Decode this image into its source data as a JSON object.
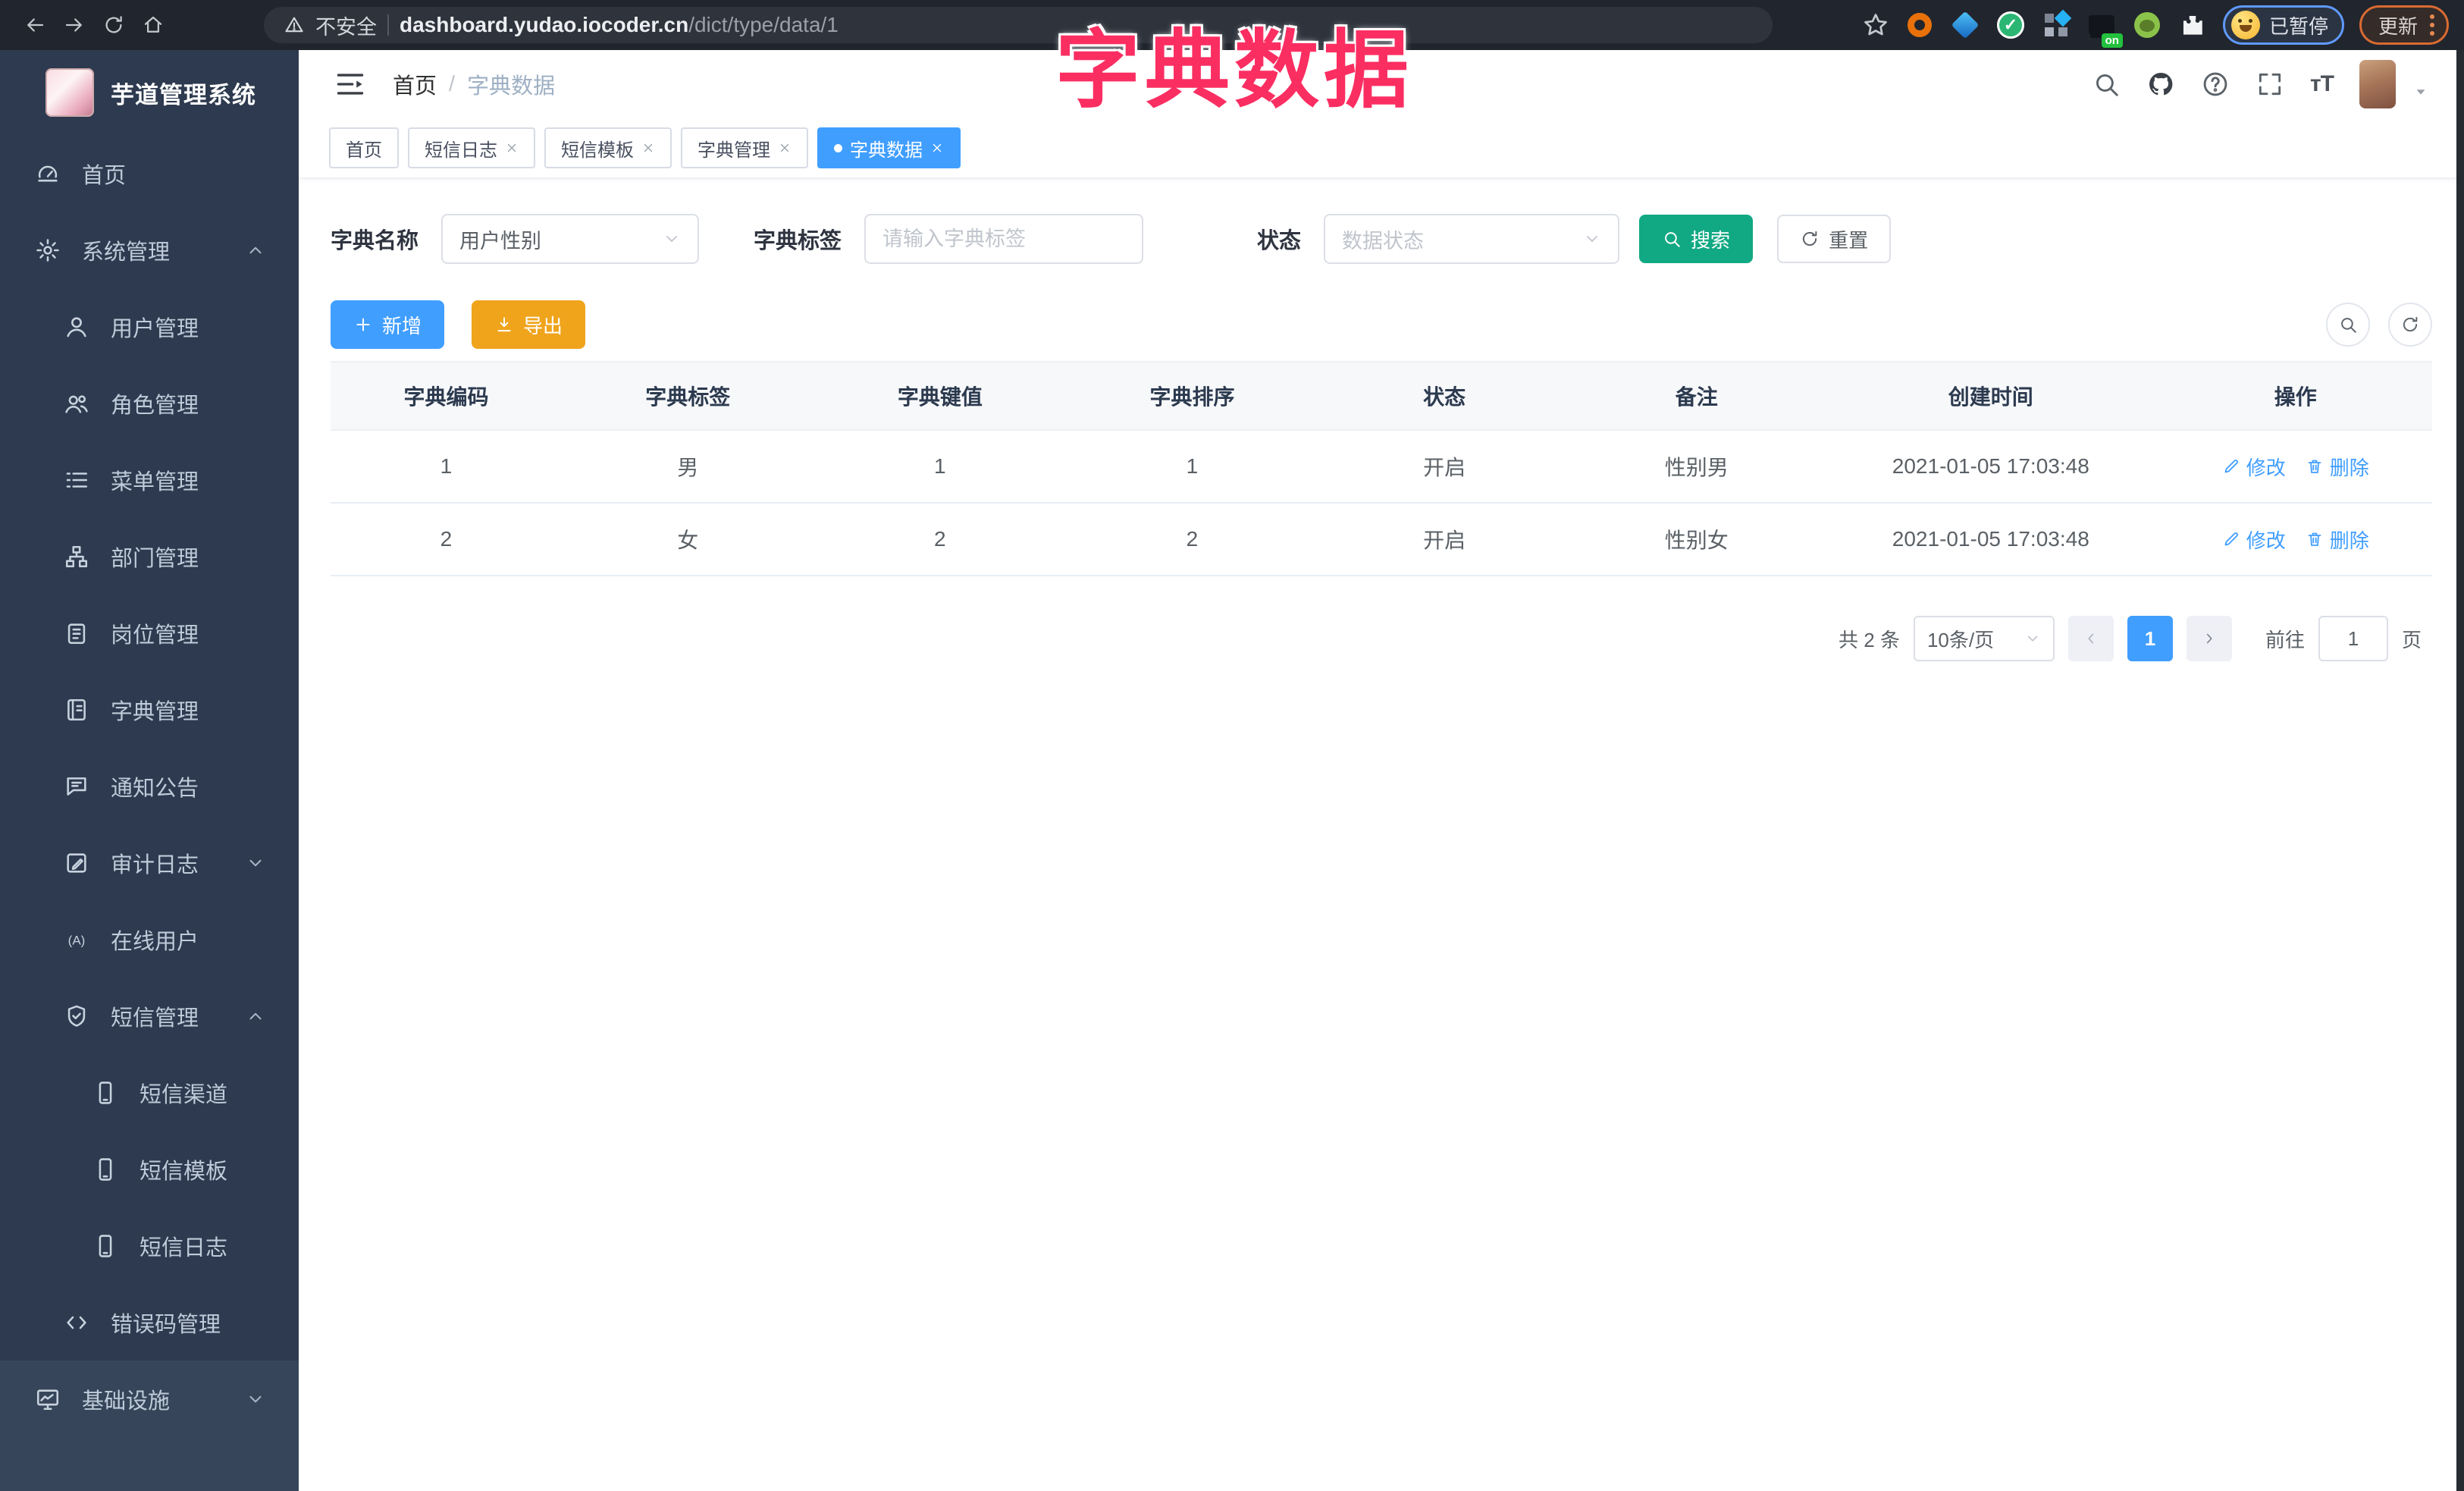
{
  "browser": {
    "security_label": "不安全",
    "url_host": "dashboard.yudao.iocoder.cn",
    "url_path": "/dict/type/data/1",
    "profile_label": "已暂停",
    "update_label": "更新"
  },
  "annotation": {
    "title": "字典数据",
    "color": "#fb2e62"
  },
  "sidebar": {
    "title": "芋道管理系统",
    "items": [
      {
        "label": "首页"
      },
      {
        "label": "系统管理"
      },
      {
        "label": "用户管理"
      },
      {
        "label": "角色管理"
      },
      {
        "label": "菜单管理"
      },
      {
        "label": "部门管理"
      },
      {
        "label": "岗位管理"
      },
      {
        "label": "字典管理"
      },
      {
        "label": "通知公告"
      },
      {
        "label": "审计日志"
      },
      {
        "label": "在线用户"
      },
      {
        "label": "短信管理"
      },
      {
        "label": "短信渠道"
      },
      {
        "label": "短信模板"
      },
      {
        "label": "短信日志"
      },
      {
        "label": "错误码管理"
      },
      {
        "label": "基础设施"
      }
    ]
  },
  "navbar": {
    "breadcrumb_home": "首页",
    "breadcrumb_sep": "/",
    "breadcrumb_current": "字典数据"
  },
  "tabs": {
    "items": [
      {
        "label": "首页",
        "closable": false,
        "active": false
      },
      {
        "label": "短信日志",
        "closable": true,
        "active": false
      },
      {
        "label": "短信模板",
        "closable": true,
        "active": false
      },
      {
        "label": "字典管理",
        "closable": true,
        "active": false
      },
      {
        "label": "字典数据",
        "closable": true,
        "active": true
      }
    ]
  },
  "filters": {
    "dict_name_label": "字典名称",
    "dict_name_value": "用户性别",
    "dict_label_label": "字典标签",
    "dict_label_placeholder": "请输入字典标签",
    "status_label": "状态",
    "status_placeholder": "数据状态",
    "search_label": "搜索",
    "reset_label": "重置"
  },
  "toolbar": {
    "add_label": "新增",
    "export_label": "导出"
  },
  "table": {
    "headers": [
      "字典编码",
      "字典标签",
      "字典键值",
      "字典排序",
      "状态",
      "备注",
      "创建时间",
      "操作"
    ],
    "rows": [
      {
        "code": "1",
        "label": "男",
        "value": "1",
        "sort": "1",
        "status": "开启",
        "remark": "性别男",
        "created": "2021-01-05 17:03:48"
      },
      {
        "code": "2",
        "label": "女",
        "value": "2",
        "sort": "2",
        "status": "开启",
        "remark": "性别女",
        "created": "2021-01-05 17:03:48"
      }
    ],
    "edit_label": "修改",
    "delete_label": "删除"
  },
  "pagination": {
    "total": "共 2 条",
    "page_size": "10条/页",
    "page": "1",
    "goto_label": "前往",
    "goto_value": "1",
    "unit_label": "页"
  },
  "colors": {
    "primary": "#409eff",
    "success": "#11a983",
    "warning": "#efa41c",
    "annotation": "#fb2e62",
    "sidebar_bg": "#2d3a4f"
  }
}
